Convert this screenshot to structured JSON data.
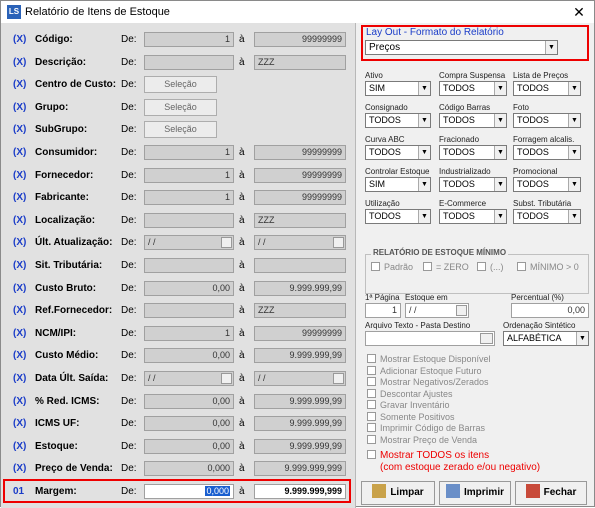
{
  "window": {
    "title": "Relatório de Itens de Estoque",
    "icon_text": "LS",
    "close": "✕"
  },
  "left": {
    "de_label": "De:",
    "a_label": "à",
    "rows": [
      {
        "label": "Código:",
        "from": "1",
        "to": "99999999"
      },
      {
        "label": "Descrição:",
        "from": "",
        "to": "ZZZ"
      },
      {
        "label": "Centro de Custo:",
        "button": "Seleção"
      },
      {
        "label": "Grupo:",
        "button": "Seleção"
      },
      {
        "label": "SubGrupo:",
        "button": "Seleção"
      },
      {
        "label": "Consumidor:",
        "from": "1",
        "to": "99999999"
      },
      {
        "label": "Fornecedor:",
        "from": "1",
        "to": "99999999"
      },
      {
        "label": "Fabricante:",
        "from": "1",
        "to": "99999999"
      },
      {
        "label": "Localização:",
        "from": "",
        "to": "ZZZ"
      },
      {
        "label": "Últ. Atualização:",
        "from": "/ /",
        "to": "/ /"
      },
      {
        "label": "Sit. Tributária:",
        "from": "",
        "to": ""
      },
      {
        "label": "Custo Bruto:",
        "from": "0,00",
        "to": "9.999.999,99"
      },
      {
        "label": "Ref.Fornecedor:",
        "from": "",
        "to": "ZZZ"
      },
      {
        "label": "NCM/IPI:",
        "from": "1",
        "to": "99999999"
      },
      {
        "label": "Custo Médio:",
        "from": "0,00",
        "to": "9.999.999,99"
      },
      {
        "label": "Data Últ. Saída:",
        "from": "/ /",
        "to": "/ /"
      },
      {
        "label": "% Red. ICMS:",
        "from": "0,00",
        "to": "9.999.999,99"
      },
      {
        "label": "ICMS UF:",
        "from": "0,00",
        "to": "9.999.999,99"
      },
      {
        "label": "Estoque:",
        "from": "0,00",
        "to": "9.999.999,99"
      },
      {
        "label": "Preço de Venda:",
        "from": "0,000",
        "to": "9.999.999,999"
      },
      {
        "label": "Margem:",
        "from": "0,000",
        "to": "9.999.999,999"
      }
    ]
  },
  "right": {
    "layout_title": "Lay Out - Formato do Relatório",
    "layout_value": "Preços",
    "filters": [
      {
        "label": "Ativo",
        "value": "SIM"
      },
      {
        "label": "Compra Suspensa",
        "value": "TODOS"
      },
      {
        "label": "Lista de Preços",
        "value": "TODOS"
      },
      {
        "label": "Consignado",
        "value": "TODOS"
      },
      {
        "label": "Código Barras",
        "value": "TODOS"
      },
      {
        "label": "Foto",
        "value": "TODOS"
      },
      {
        "label": "Curva ABC",
        "value": "TODOS"
      },
      {
        "label": "Fracionado",
        "value": "TODOS"
      },
      {
        "label": "Forragem alcalis.",
        "value": "TODOS"
      },
      {
        "label": "Controlar Estoque",
        "value": "SIM"
      },
      {
        "label": "Industrializado",
        "value": "TODOS"
      },
      {
        "label": "Promocional",
        "value": "TODOS"
      },
      {
        "label": "Utilização",
        "value": "TODOS"
      },
      {
        "label": "E-Commerce",
        "value": "TODOS"
      },
      {
        "label": "Subst. Tributária",
        "value": "TODOS"
      }
    ],
    "minimo_title": "RELATÓRIO DE ESTOQUE MÍNIMO",
    "minimo_options": [
      "Padrão",
      "= ZERO",
      "(...)",
      "MÍNIMO > 0"
    ],
    "pagina_label": "1ª Página",
    "pagina_value": "1",
    "estoque_em_label": "Estoque em",
    "estoque_em_value": "/ /",
    "percentual_label": "Percentual (%)",
    "percentual_value": "0,00",
    "arquivo_label": "Arquivo Texto - Pasta Destino",
    "ordenacao_label": "Ordenação Sintético",
    "ordenacao_value": "ALFABÉTICA",
    "checks": [
      "Mostrar Estoque Disponível",
      "Adicionar Estoque Futuro",
      "Mostrar Negativos/Zerados",
      "Descontar Ajustes",
      "Gravar Inventário",
      "Somente Positivos",
      "Imprimir Código de Barras",
      "Mostrar Preço de Venda"
    ],
    "mostrar_todos": "Mostrar TODOS os itens",
    "mostrar_todos_sub": "(com estoque zerado e/ou negativo)",
    "buttons": {
      "limpar": "Limpar",
      "imprimir": "Imprimir",
      "fechar": "Fechar"
    }
  }
}
